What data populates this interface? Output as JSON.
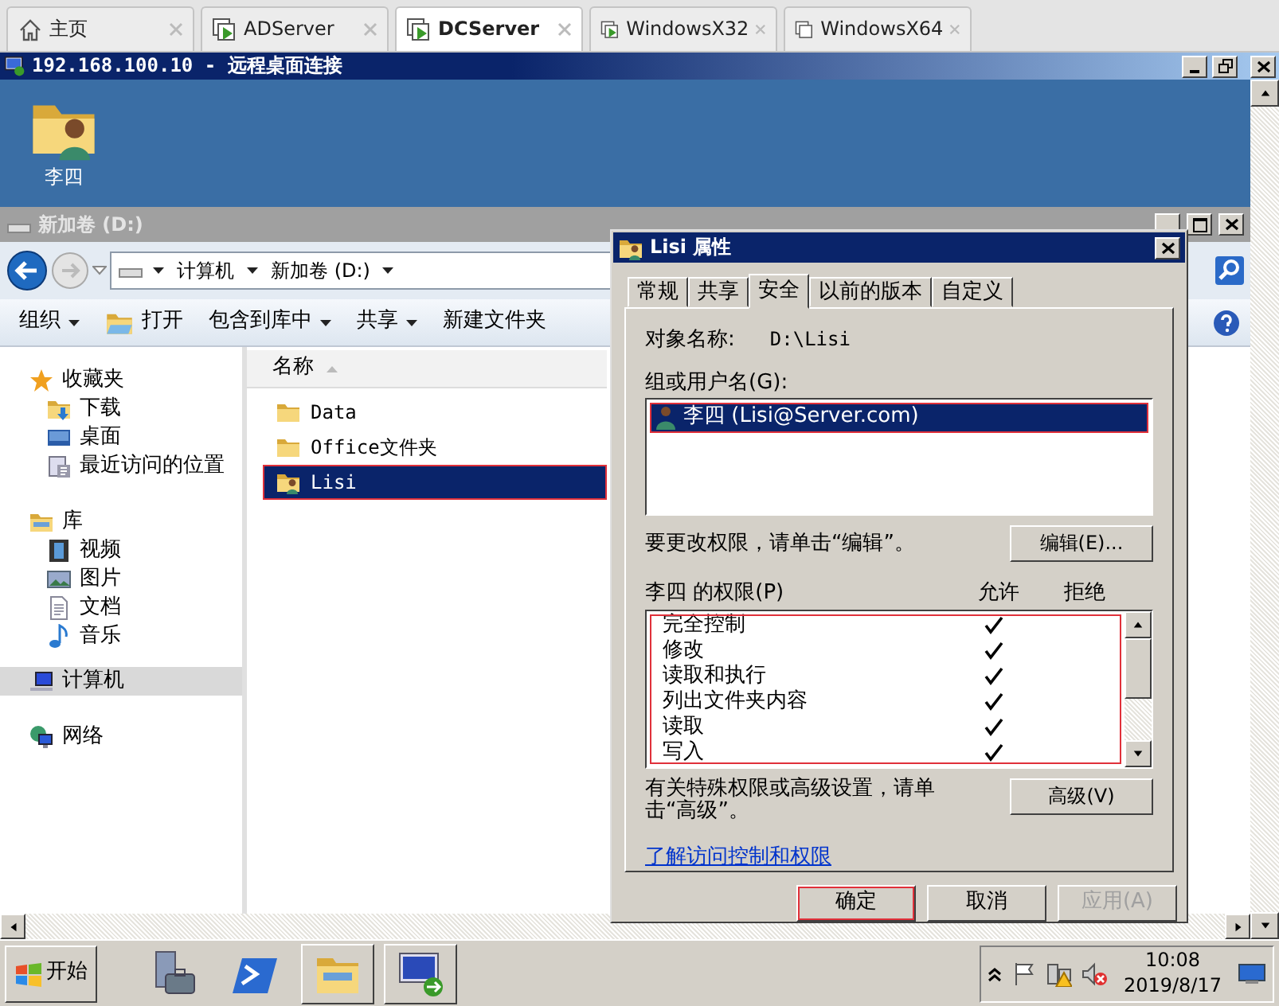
{
  "browser_tabs": [
    {
      "label": "主页",
      "selected": false,
      "kind": "home"
    },
    {
      "label": "ADServer",
      "selected": false,
      "kind": "vm-running"
    },
    {
      "label": "DCServer",
      "selected": true,
      "kind": "vm-running"
    },
    {
      "label": "WindowsX32",
      "selected": false,
      "kind": "vm-running"
    },
    {
      "label": "WindowsX64",
      "selected": false,
      "kind": "vm-off"
    }
  ],
  "remote_window": {
    "title": "192.168.100.10 - 远程桌面连接"
  },
  "desktop_icons": [
    {
      "label": "李四",
      "kind": "user-folder"
    }
  ],
  "explorer": {
    "title": "新加卷 (D:)",
    "breadcrumbs": [
      "计算机",
      "新加卷 (D:)"
    ],
    "toolbar": [
      {
        "label": "组织",
        "dropdown": true,
        "kind": "text"
      },
      {
        "label": "打开",
        "dropdown": false,
        "kind": "open"
      },
      {
        "label": "包含到库中",
        "dropdown": true,
        "kind": "text"
      },
      {
        "label": "共享",
        "dropdown": true,
        "kind": "text"
      },
      {
        "label": "新建文件夹",
        "dropdown": false,
        "kind": "text"
      }
    ],
    "nav": [
      {
        "label": "收藏夹",
        "kind": "star",
        "selected": false,
        "children": [
          {
            "label": "下载",
            "kind": "download",
            "selected": false
          },
          {
            "label": "桌面",
            "kind": "desktop",
            "selected": false
          },
          {
            "label": "最近访问的位置",
            "kind": "recent",
            "selected": false
          }
        ]
      },
      {
        "label": "库",
        "kind": "library",
        "selected": false,
        "children": [
          {
            "label": "视频",
            "kind": "video",
            "selected": false
          },
          {
            "label": "图片",
            "kind": "picture",
            "selected": false
          },
          {
            "label": "文档",
            "kind": "document",
            "selected": false
          },
          {
            "label": "音乐",
            "kind": "music",
            "selected": false
          }
        ]
      },
      {
        "label": "计算机",
        "kind": "computer",
        "selected": true
      },
      {
        "label": "网络",
        "kind": "network",
        "selected": false
      }
    ],
    "column_header": "名称",
    "files": [
      {
        "name": "Data",
        "kind": "folder",
        "selected": false,
        "highlighted": false
      },
      {
        "name": "Office文件夹",
        "kind": "folder",
        "selected": false,
        "highlighted": false
      },
      {
        "name": "Lisi",
        "kind": "user-folder",
        "selected": true,
        "highlighted": true
      }
    ]
  },
  "dialog": {
    "title": "Lisi 属性",
    "tabs": [
      {
        "label": "常规",
        "selected": false
      },
      {
        "label": "共享",
        "selected": false
      },
      {
        "label": "安全",
        "selected": true
      },
      {
        "label": "以前的版本",
        "selected": false
      },
      {
        "label": "自定义",
        "selected": false
      }
    ],
    "object_label": "对象名称:",
    "object_value": "D:\\Lisi",
    "users_label": "组或用户名(G):",
    "users": [
      {
        "name": "李四 (Lisi@Server.com)",
        "selected": true,
        "highlighted": true
      }
    ],
    "edit_hint": "要更改权限，请单击“编辑”。",
    "edit_button": "编辑(E)...",
    "permissions_label": "李四 的权限(P)",
    "allow_header": "允许",
    "deny_header": "拒绝",
    "permissions_highlighted": true,
    "permissions": [
      {
        "name": "完全控制",
        "allow": true,
        "deny": false
      },
      {
        "name": "修改",
        "allow": true,
        "deny": false
      },
      {
        "name": "读取和执行",
        "allow": true,
        "deny": false
      },
      {
        "name": "列出文件夹内容",
        "allow": true,
        "deny": false
      },
      {
        "name": "读取",
        "allow": true,
        "deny": false
      },
      {
        "name": "写入",
        "allow": true,
        "deny": false
      }
    ],
    "advanced_hint": "有关特殊权限或高级设置，请单击“高级”。",
    "advanced_button": "高级(V)",
    "link": "了解访问控制和权限",
    "buttons": [
      {
        "label": "确定",
        "highlighted": true,
        "disabled": false
      },
      {
        "label": "取消",
        "highlighted": false,
        "disabled": false
      },
      {
        "label": "应用(A)",
        "highlighted": false,
        "disabled": true
      }
    ]
  },
  "taskbar": {
    "start": "开始",
    "apps": [
      {
        "kind": "server-manager",
        "running": false
      },
      {
        "kind": "powershell",
        "running": false
      },
      {
        "kind": "explorer",
        "running": true
      },
      {
        "kind": "remote-desktop",
        "running": true
      }
    ],
    "time": "10:08",
    "date": "2019/8/17"
  }
}
